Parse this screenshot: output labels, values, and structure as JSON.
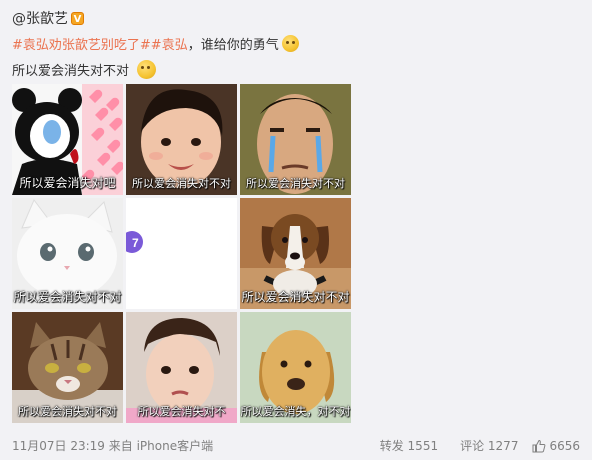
{
  "author": {
    "name": "@张歆艺",
    "badge": "V"
  },
  "post": {
    "topic1": "#袁弘劝张歆艺别吃了#",
    "topic2": "袁弘",
    "text1": "，谁给你的勇气",
    "text2": "所以爱会消失对不对"
  },
  "images": [
    {
      "caption": "所以爱会消失对吧"
    },
    {
      "caption": "所以爱会消失对不对"
    },
    {
      "caption": "所以爱会消失对不对"
    },
    {
      "caption": "所以爱会消失对不对"
    },
    {
      "caption": ""
    },
    {
      "caption": "所以爱会消失对不对"
    },
    {
      "caption": "所以爱会消失对不对"
    },
    {
      "caption": "所以爱会消失对不"
    },
    {
      "caption": "所以爱会消失，对不对"
    }
  ],
  "footer": {
    "meta": "11月07日 23:19  来自 iPhone客户端",
    "repost": "转发 1551",
    "comment": "评论 1277",
    "likes": "6656"
  },
  "colors": {
    "topic": "#eb7350",
    "text": "#333333",
    "meta": "#808080"
  }
}
